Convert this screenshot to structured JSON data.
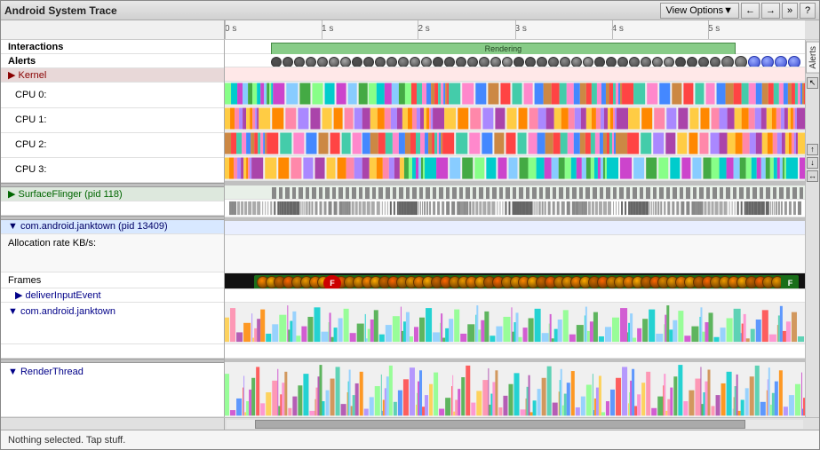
{
  "title": "Android System Trace",
  "header": {
    "view_options_label": "View Options▼",
    "nav_back": "←",
    "nav_forward": "→",
    "nav_expand": "»",
    "help": "?"
  },
  "time_ruler": {
    "ticks": [
      "0 s",
      "1 s",
      "2 s",
      "3 s",
      "4 s",
      "5 s"
    ]
  },
  "sections": {
    "interactions": {
      "label": "Interactions",
      "rendering_label": "Rendering"
    },
    "alerts": {
      "label": "Alerts"
    },
    "kernel": {
      "label": "▶ Kernel",
      "expanded": false
    },
    "cpu0": {
      "label": "CPU 0:"
    },
    "cpu1": {
      "label": "CPU 1:"
    },
    "cpu2": {
      "label": "CPU 2:"
    },
    "cpu3": {
      "label": "CPU 3:"
    },
    "surface_flinger": {
      "label": "▶ SurfaceFlinger (pid 118)"
    },
    "janktown": {
      "label": "▼ com.android.janktown (pid 13409)"
    },
    "alloc_rate": {
      "label": "Allocation rate KB/s:"
    },
    "frames": {
      "label": "Frames"
    },
    "deliver_input": {
      "label": "▶ deliverInputEvent"
    },
    "com_janktown": {
      "label": "▼ com.android.janktown"
    },
    "render_thread": {
      "label": "▼ RenderThread"
    }
  },
  "alerts_tab": {
    "label": "Alerts"
  },
  "status_bar": {
    "text": "Nothing selected. Tap stuff."
  },
  "colors": {
    "background": "#ffffff",
    "header_bg": "#d8d8d8",
    "kernel_bg": "#ffcccc",
    "janktown_bg": "#ddeeff",
    "rendering_green": "#88cc88",
    "cpu_colors": [
      "#cc44cc",
      "#44cc44",
      "#4488ff",
      "#ffaa00",
      "#ff4444",
      "#00cccc",
      "#aa88ff",
      "#ff88aa"
    ],
    "frame_green": "#228822",
    "frame_red": "#cc0000"
  }
}
